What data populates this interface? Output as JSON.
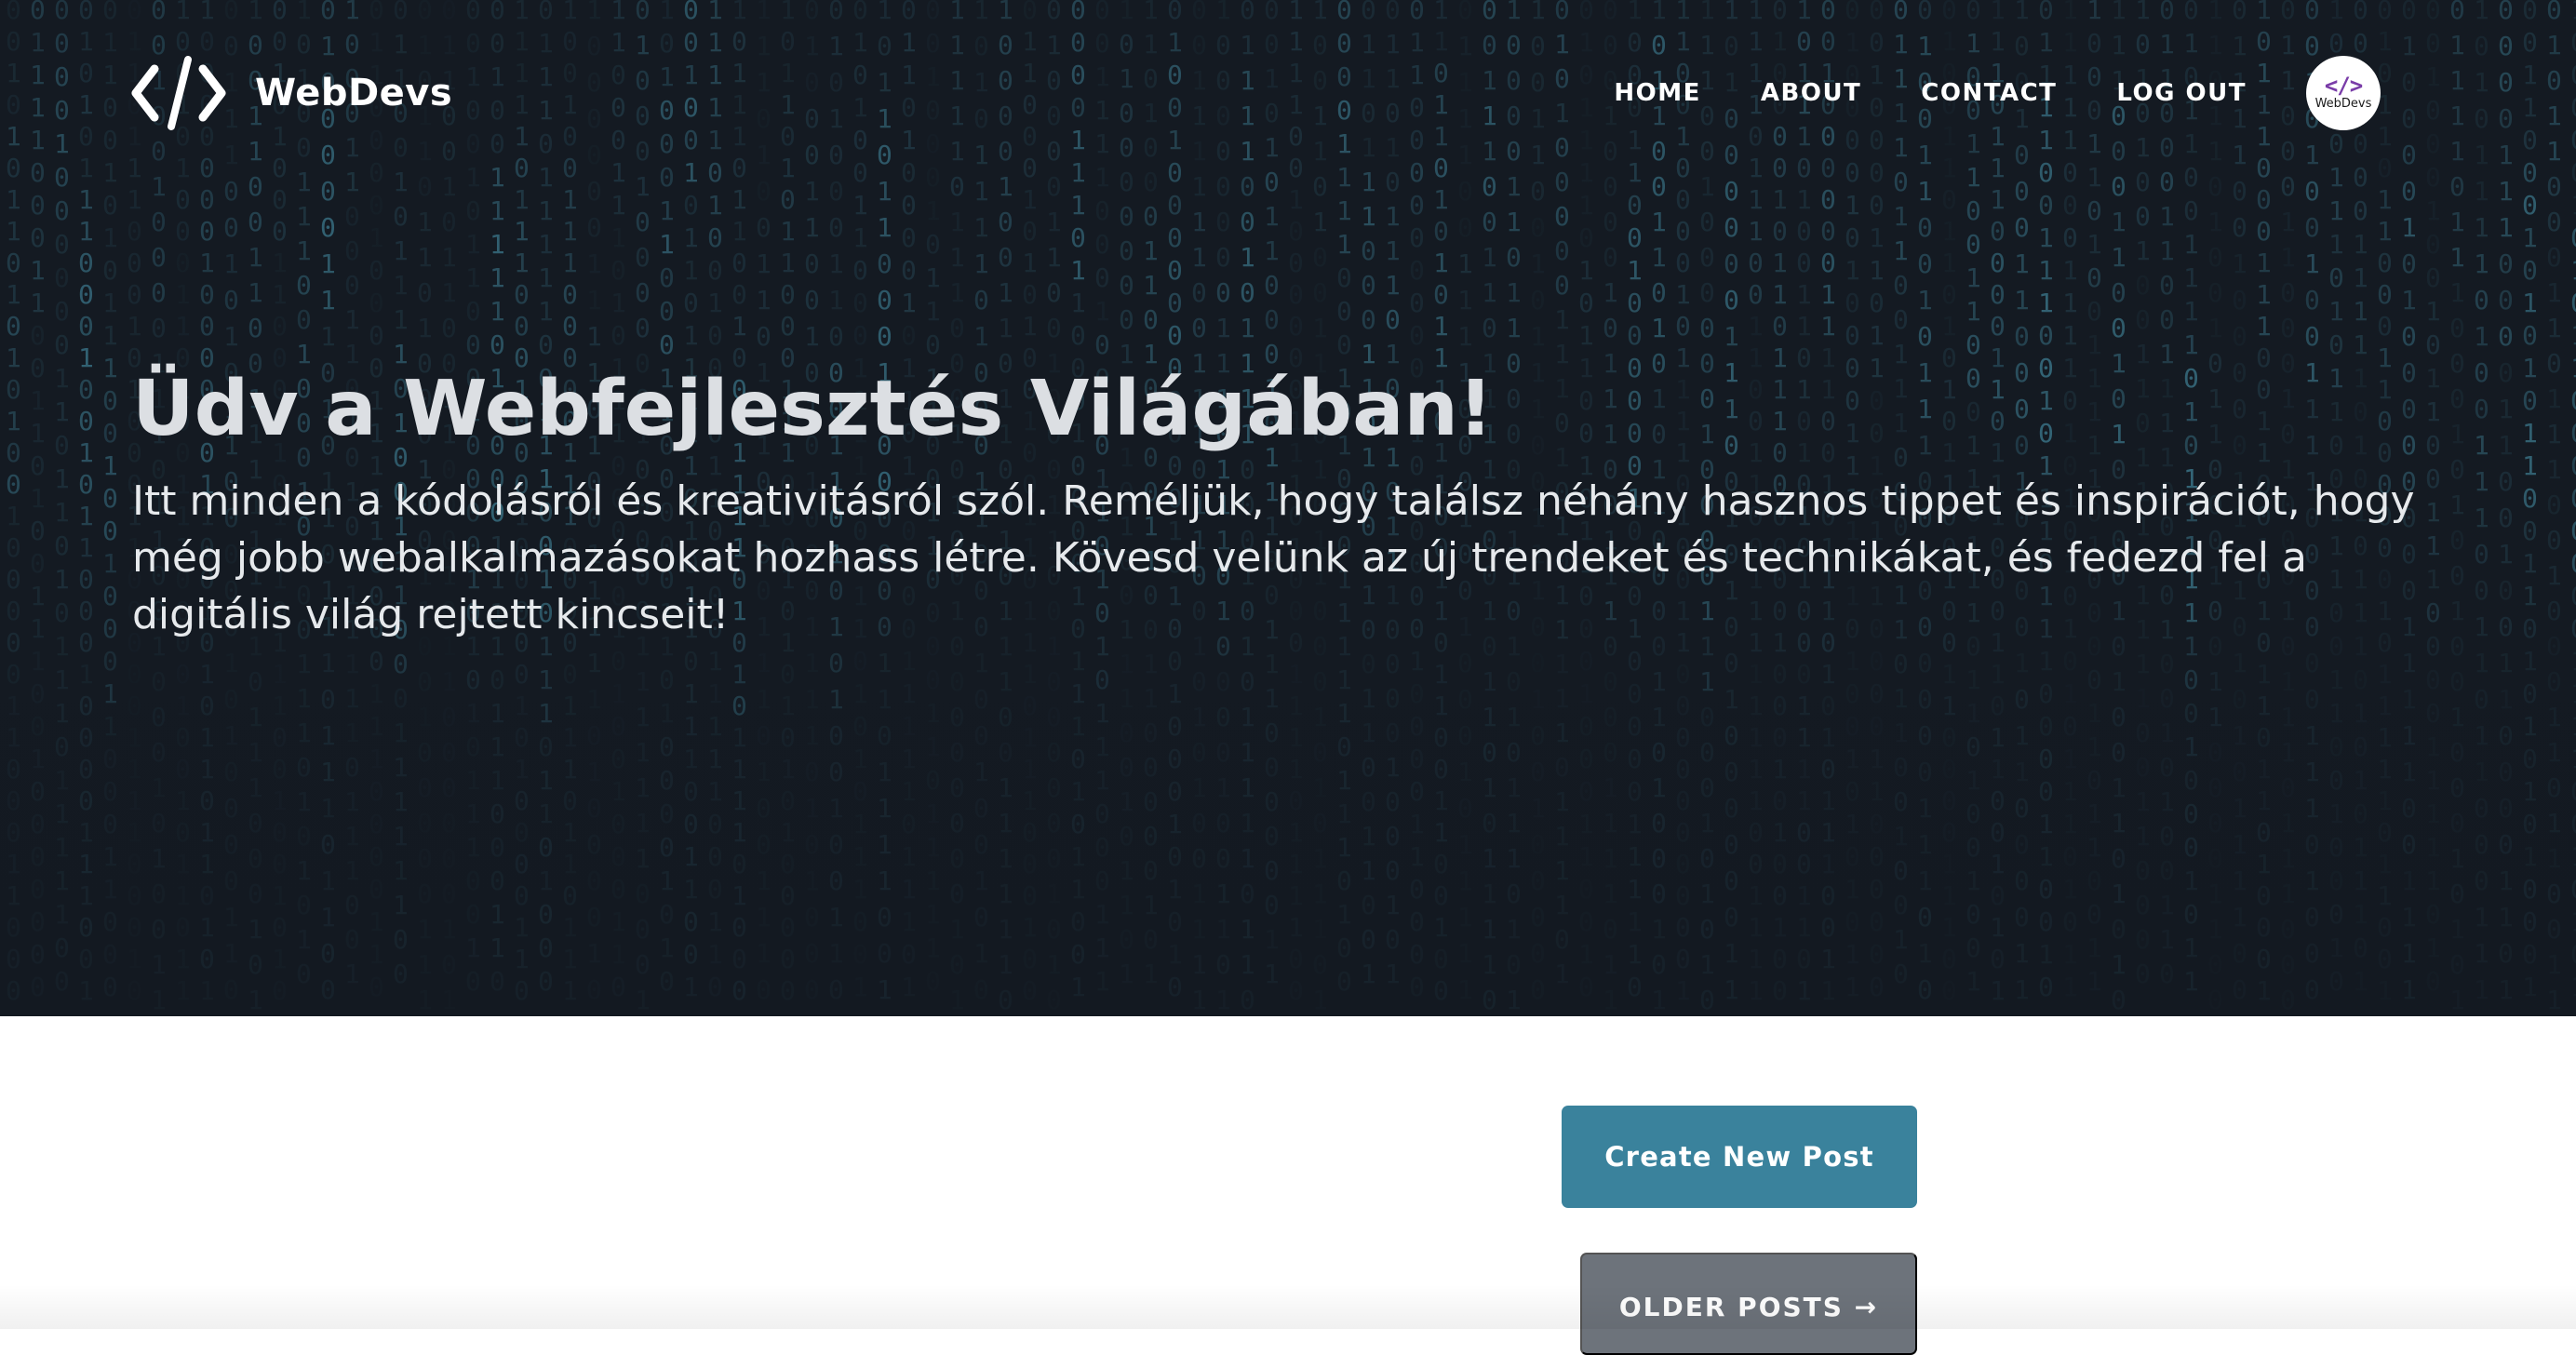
{
  "brand": {
    "glyph": "</>",
    "name": "WebDevs"
  },
  "nav": {
    "links": [
      "HOME",
      "ABOUT",
      "CONTACT",
      "LOG OUT"
    ]
  },
  "avatar": {
    "glyph": "</>",
    "label": "WebDevs"
  },
  "hero": {
    "title": "Üdv a Webfejlesztés Világában!",
    "subtitle": "Itt minden a kódolásról és kreativitásról szól. Reméljük, hogy találsz néhány hasznos tippet és inspirációt, hogy még jobb webalkalmazásokat hozhass létre. Kövesd velünk az új trendeket és technikákat, és fedezd fel a digitális világ rejtett kincseit!"
  },
  "actions": {
    "create_label": "Create New Post",
    "older_label": "OLDER POSTS →"
  },
  "colors": {
    "hero_bg": "#141a22",
    "matrix_digit": "#4fa6c0",
    "create_button": "#3a829c",
    "older_button": "#6d737b",
    "avatar_glyph": "#7a3da8"
  }
}
